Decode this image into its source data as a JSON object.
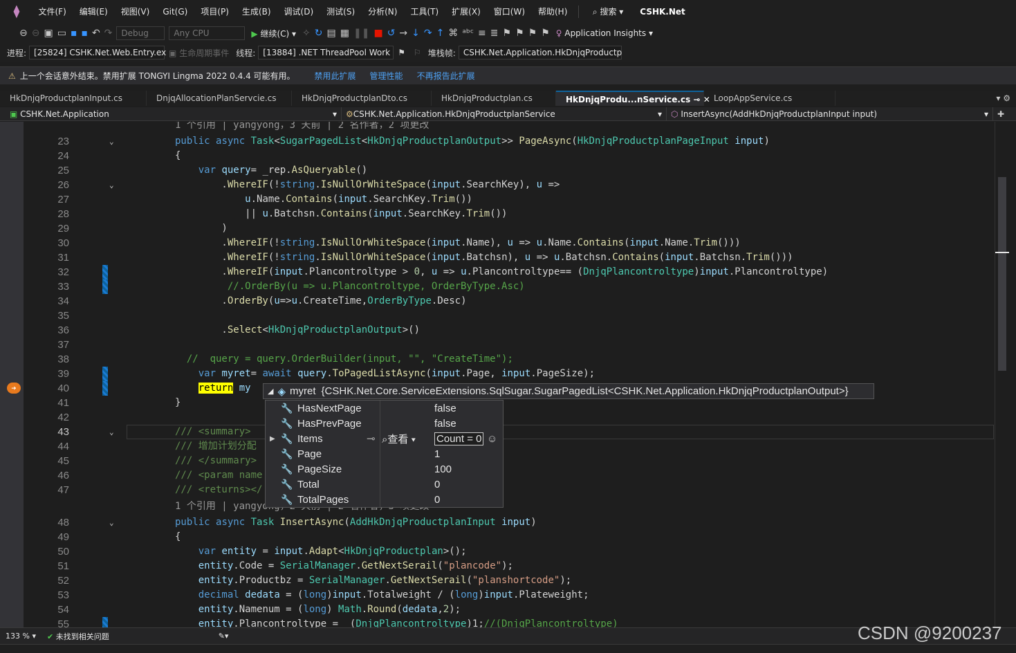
{
  "menubar": {
    "items": [
      "文件(F)",
      "编辑(E)",
      "视图(V)",
      "Git(G)",
      "项目(P)",
      "生成(B)",
      "调试(D)",
      "测试(S)",
      "分析(N)",
      "工具(T)",
      "扩展(X)",
      "窗口(W)",
      "帮助(H)"
    ],
    "search_label": "搜索",
    "title": "CSHK.Net"
  },
  "toolbar": {
    "config": "Debug",
    "platform": "Any CPU",
    "continue_label": "继续(C)",
    "insights_label": "Application Insights"
  },
  "debug": {
    "process_label": "进程:",
    "process_value": "[25824] CSHK.Net.Web.Entry.ex",
    "lifecycle_label": "生命周期事件",
    "thread_label": "线程:",
    "thread_value": "[13884] .NET ThreadPool Work",
    "stack_label": "堆栈帧:",
    "stack_value": "CSHK.Net.Application.HkDnjqProductp"
  },
  "infobar": {
    "message": "上一个会话意外结束。禁用扩展 TONGYI Lingma 2022 0.4.4 可能有用。",
    "links": [
      "禁用此扩展",
      "管理性能",
      "不再报告此扩展"
    ]
  },
  "tabs": [
    "HkDnjqProductplanInput.cs",
    "DnjqAllocationPlanServcie.cs",
    "HkDnjqProductplanDto.cs",
    "HkDnjqProductplan.cs",
    "HkDnjqProdu...nService.cs",
    "LoopAppService.cs"
  ],
  "active_tab": "HkDnjqProdu...nService.cs",
  "navbar": {
    "project": "CSHK.Net.Application",
    "class": "CSHK.Net.Application.HkDnjqProductplanService",
    "member": "InsertAsync(AddHkDnjqProductplanInput input)"
  },
  "editor": {
    "codelens_top": "1 个引用 | yangyong，3 天前 | 2 名作者，2 项更改",
    "codelens_mid": "1 个引用 | yangyong，2 天前 | 2 名作者，3 项更改",
    "line_numbers": [
      "23",
      "24",
      "25",
      "26",
      "27",
      "28",
      "29",
      "30",
      "31",
      "32",
      "33",
      "34",
      "35",
      "36",
      "37",
      "38",
      "39",
      "40",
      "41",
      "42",
      "43",
      "44",
      "45",
      "46",
      "47",
      "48",
      "49",
      "50",
      "51",
      "52",
      "53",
      "54",
      "55"
    ]
  },
  "datatip": {
    "header_name": "myret",
    "header_value": "{CSHK.Net.Core.ServiceExtensions.SqlSugar.SugarPagedList<CSHK.Net.Application.HkDnjqProductplanOutput>}",
    "rows": [
      {
        "name": "HasNextPage",
        "value": "false"
      },
      {
        "name": "HasPrevPage",
        "value": "false"
      },
      {
        "name": "Items",
        "value": "Count = 0"
      },
      {
        "name": "Page",
        "value": "1"
      },
      {
        "name": "PageSize",
        "value": "100"
      },
      {
        "name": "Total",
        "value": "0"
      },
      {
        "name": "TotalPages",
        "value": "0"
      }
    ],
    "view_label": "查看"
  },
  "statusbar": {
    "zoom": "133 %",
    "issues": "未找到相关问题"
  },
  "watermark": "CSDN @9200237"
}
